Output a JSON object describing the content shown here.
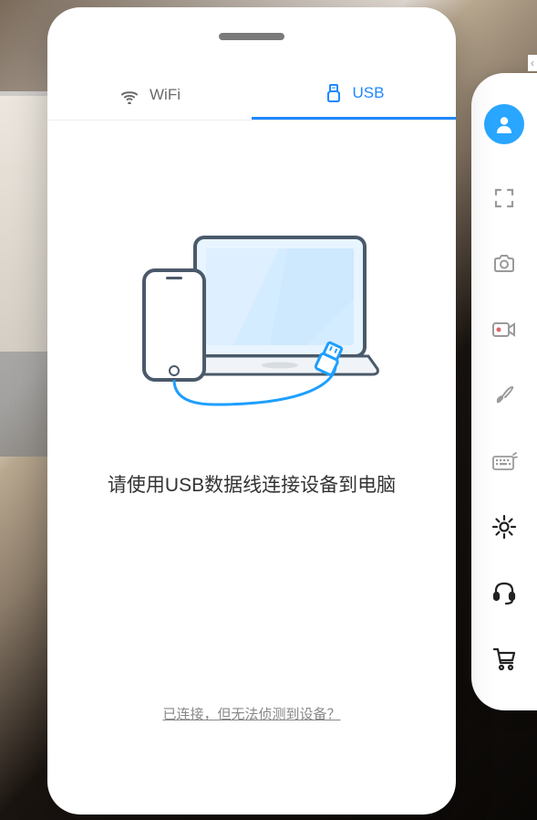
{
  "tabs": {
    "wifi": {
      "label": "WiFi"
    },
    "usb": {
      "label": "USB"
    }
  },
  "connect": {
    "message": "请使用USB数据线连接设备到电脑"
  },
  "help": {
    "link_text": "已连接，但无法侦测到设备？"
  },
  "toolbar": {
    "user": "user",
    "expand": "expand",
    "camera": "camera",
    "record": "record",
    "brush": "brush",
    "keyboard": "keyboard",
    "settings": "settings",
    "support": "support",
    "cart": "cart"
  },
  "colors": {
    "accent": "#1e88ff",
    "user_bg": "#29a6ff"
  }
}
